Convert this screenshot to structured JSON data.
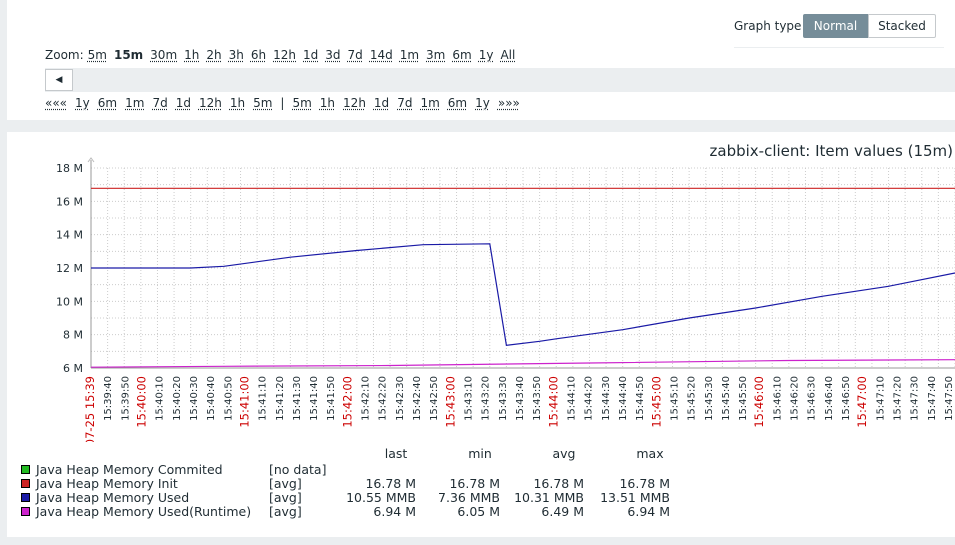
{
  "graph_type": {
    "label": "Graph type",
    "options": [
      "Normal",
      "Stacked"
    ],
    "selected": "Normal"
  },
  "zoom": {
    "label": "Zoom:",
    "items": [
      "5m",
      "15m",
      "30m",
      "1h",
      "2h",
      "3h",
      "6h",
      "12h",
      "1d",
      "3d",
      "7d",
      "14d",
      "1m",
      "3m",
      "6m",
      "1y",
      "All"
    ],
    "active": "15m"
  },
  "timeline_nav": {
    "back_items": [
      "«««",
      "1y",
      "6m",
      "1m",
      "7d",
      "1d",
      "12h",
      "1h",
      "5m"
    ],
    "separator": "|",
    "forward_items": [
      "5m",
      "1h",
      "12h",
      "1d",
      "7d",
      "1m",
      "6m",
      "1y",
      "»»»"
    ]
  },
  "colors": {
    "accent": "#768d99",
    "grid": "#cccccc",
    "red_label": "#cc0000"
  },
  "chart_data": {
    "type": "line",
    "title": "zabbix-client: Item values (15m)",
    "ylim": [
      6,
      18
    ],
    "y_ticks": [
      "6 M",
      "8 M",
      "10 M",
      "12 M",
      "14 M",
      "16 M",
      "18 M"
    ],
    "x_first_label": "07-25 15:39",
    "x_labels": [
      "15:39:40",
      "15:39:50",
      "15:40:00",
      "15:40:10",
      "15:40:20",
      "15:40:30",
      "15:40:40",
      "15:40:50",
      "15:41:00",
      "15:41:10",
      "15:41:20",
      "15:41:30",
      "15:41:40",
      "15:41:50",
      "15:42:00",
      "15:42:10",
      "15:42:20",
      "15:42:30",
      "15:42:40",
      "15:42:50",
      "15:43:00",
      "15:43:10",
      "15:43:20",
      "15:43:30",
      "15:43:40",
      "15:43:50",
      "15:44:00",
      "15:44:10",
      "15:44:20",
      "15:44:30",
      "15:44:40",
      "15:44:50",
      "15:45:00",
      "15:45:10",
      "15:45:20",
      "15:45:30",
      "15:45:40",
      "15:45:50",
      "15:46:00",
      "15:46:10",
      "15:46:20",
      "15:46:30",
      "15:46:40",
      "15:46:50",
      "15:47:00",
      "15:47:10",
      "15:47:20",
      "15:47:30",
      "15:47:40",
      "15:47:50"
    ],
    "x_red_labels": [
      "07-25 15:39",
      "15:40:00",
      "15:41:00",
      "15:42:00",
      "15:43:00",
      "15:44:00",
      "15:45:00",
      "15:46:00",
      "15:47:00"
    ],
    "series": [
      {
        "name": "Java Heap Memory Commited",
        "color": "#22bb22",
        "fn": "[no data]",
        "last": "",
        "min": "",
        "avg": "",
        "max": "",
        "x": [],
        "y": []
      },
      {
        "name": "Java Heap Memory Init",
        "color": "#cc2222",
        "fn": "[avg]",
        "last": "16.78 M",
        "min": "16.78 M",
        "avg": "16.78 M",
        "max": "16.78 M",
        "x": [
          0,
          52
        ],
        "y": [
          16.78,
          16.78
        ]
      },
      {
        "name": "Java Heap Memory Used",
        "color": "#1a1aa6",
        "fn": "[avg]",
        "last": "10.55 MMB",
        "min": "7.36 MMB",
        "avg": "10.31 MMB",
        "max": "13.51 MMB",
        "x": [
          0,
          6,
          8,
          12,
          16,
          20,
          24,
          25,
          27,
          28,
          32,
          36,
          40,
          44,
          48,
          52
        ],
        "y": [
          12.0,
          12.0,
          12.1,
          12.65,
          13.05,
          13.4,
          13.45,
          7.36,
          7.6,
          7.75,
          8.3,
          9.0,
          9.6,
          10.3,
          10.9,
          11.7
        ]
      },
      {
        "name": "Java Heap Memory Used(Runtime)",
        "color": "#cc22cc",
        "fn": "[avg]",
        "last": "6.94 M",
        "min": "6.05 M",
        "avg": "6.49 M",
        "max": "6.94 M",
        "x": [
          0,
          8,
          18,
          30,
          42,
          52
        ],
        "y": [
          6.05,
          6.1,
          6.15,
          6.3,
          6.45,
          6.5
        ]
      }
    ],
    "legend_headers": [
      "last",
      "min",
      "avg",
      "max"
    ]
  }
}
